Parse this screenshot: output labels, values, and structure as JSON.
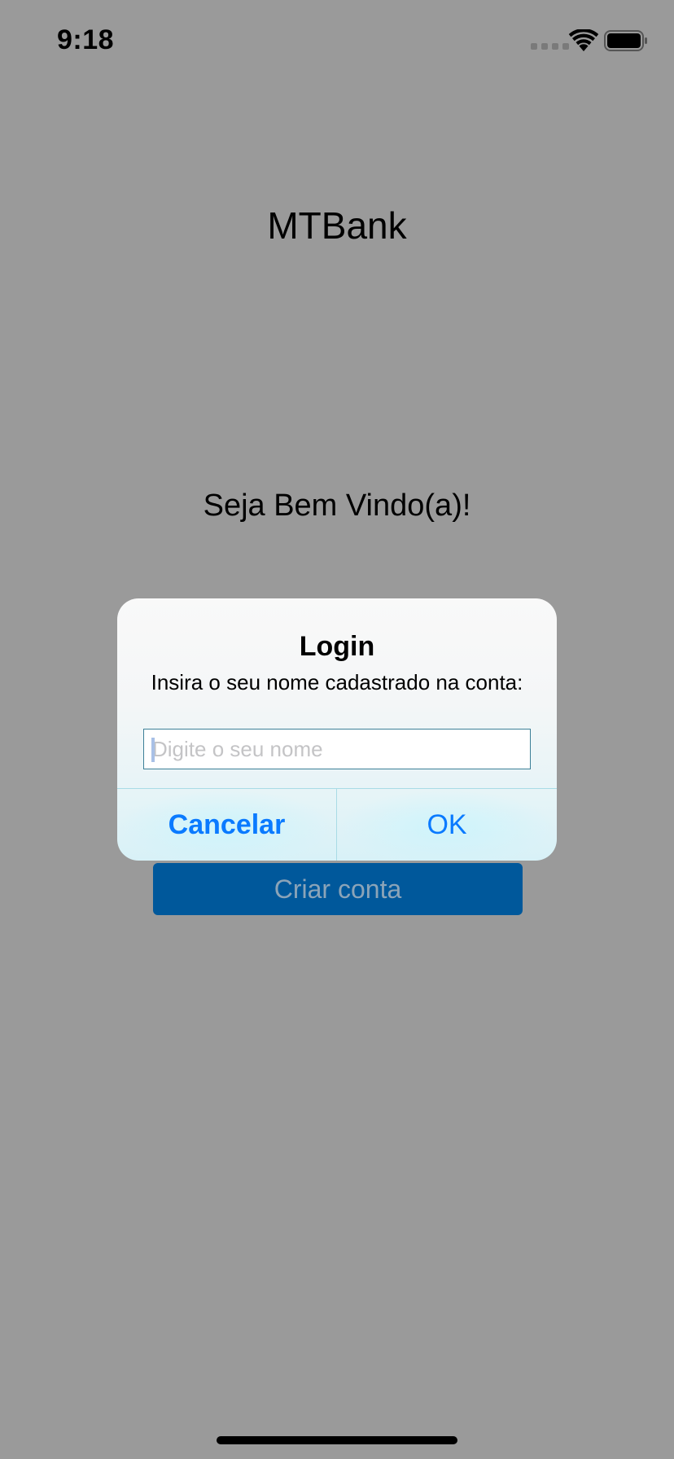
{
  "status_bar": {
    "time": "9:18",
    "icons": [
      "signal-dots-icon",
      "wifi-icon",
      "battery-icon"
    ]
  },
  "main": {
    "title": "MTBank",
    "welcome": "Seja Bem Vindo(a)!",
    "create_account_label": "Criar conta"
  },
  "alert": {
    "title": "Login",
    "message": "Insira o seu nome cadastrado na conta:",
    "input": {
      "value": "",
      "placeholder": "Digite o seu nome"
    },
    "cancel_label": "Cancelar",
    "ok_label": "OK"
  },
  "colors": {
    "background_dim": "#9a9a9a",
    "primary_button": "#00589b",
    "alert_action": "#0a7aff",
    "input_border": "#3c7f97"
  }
}
